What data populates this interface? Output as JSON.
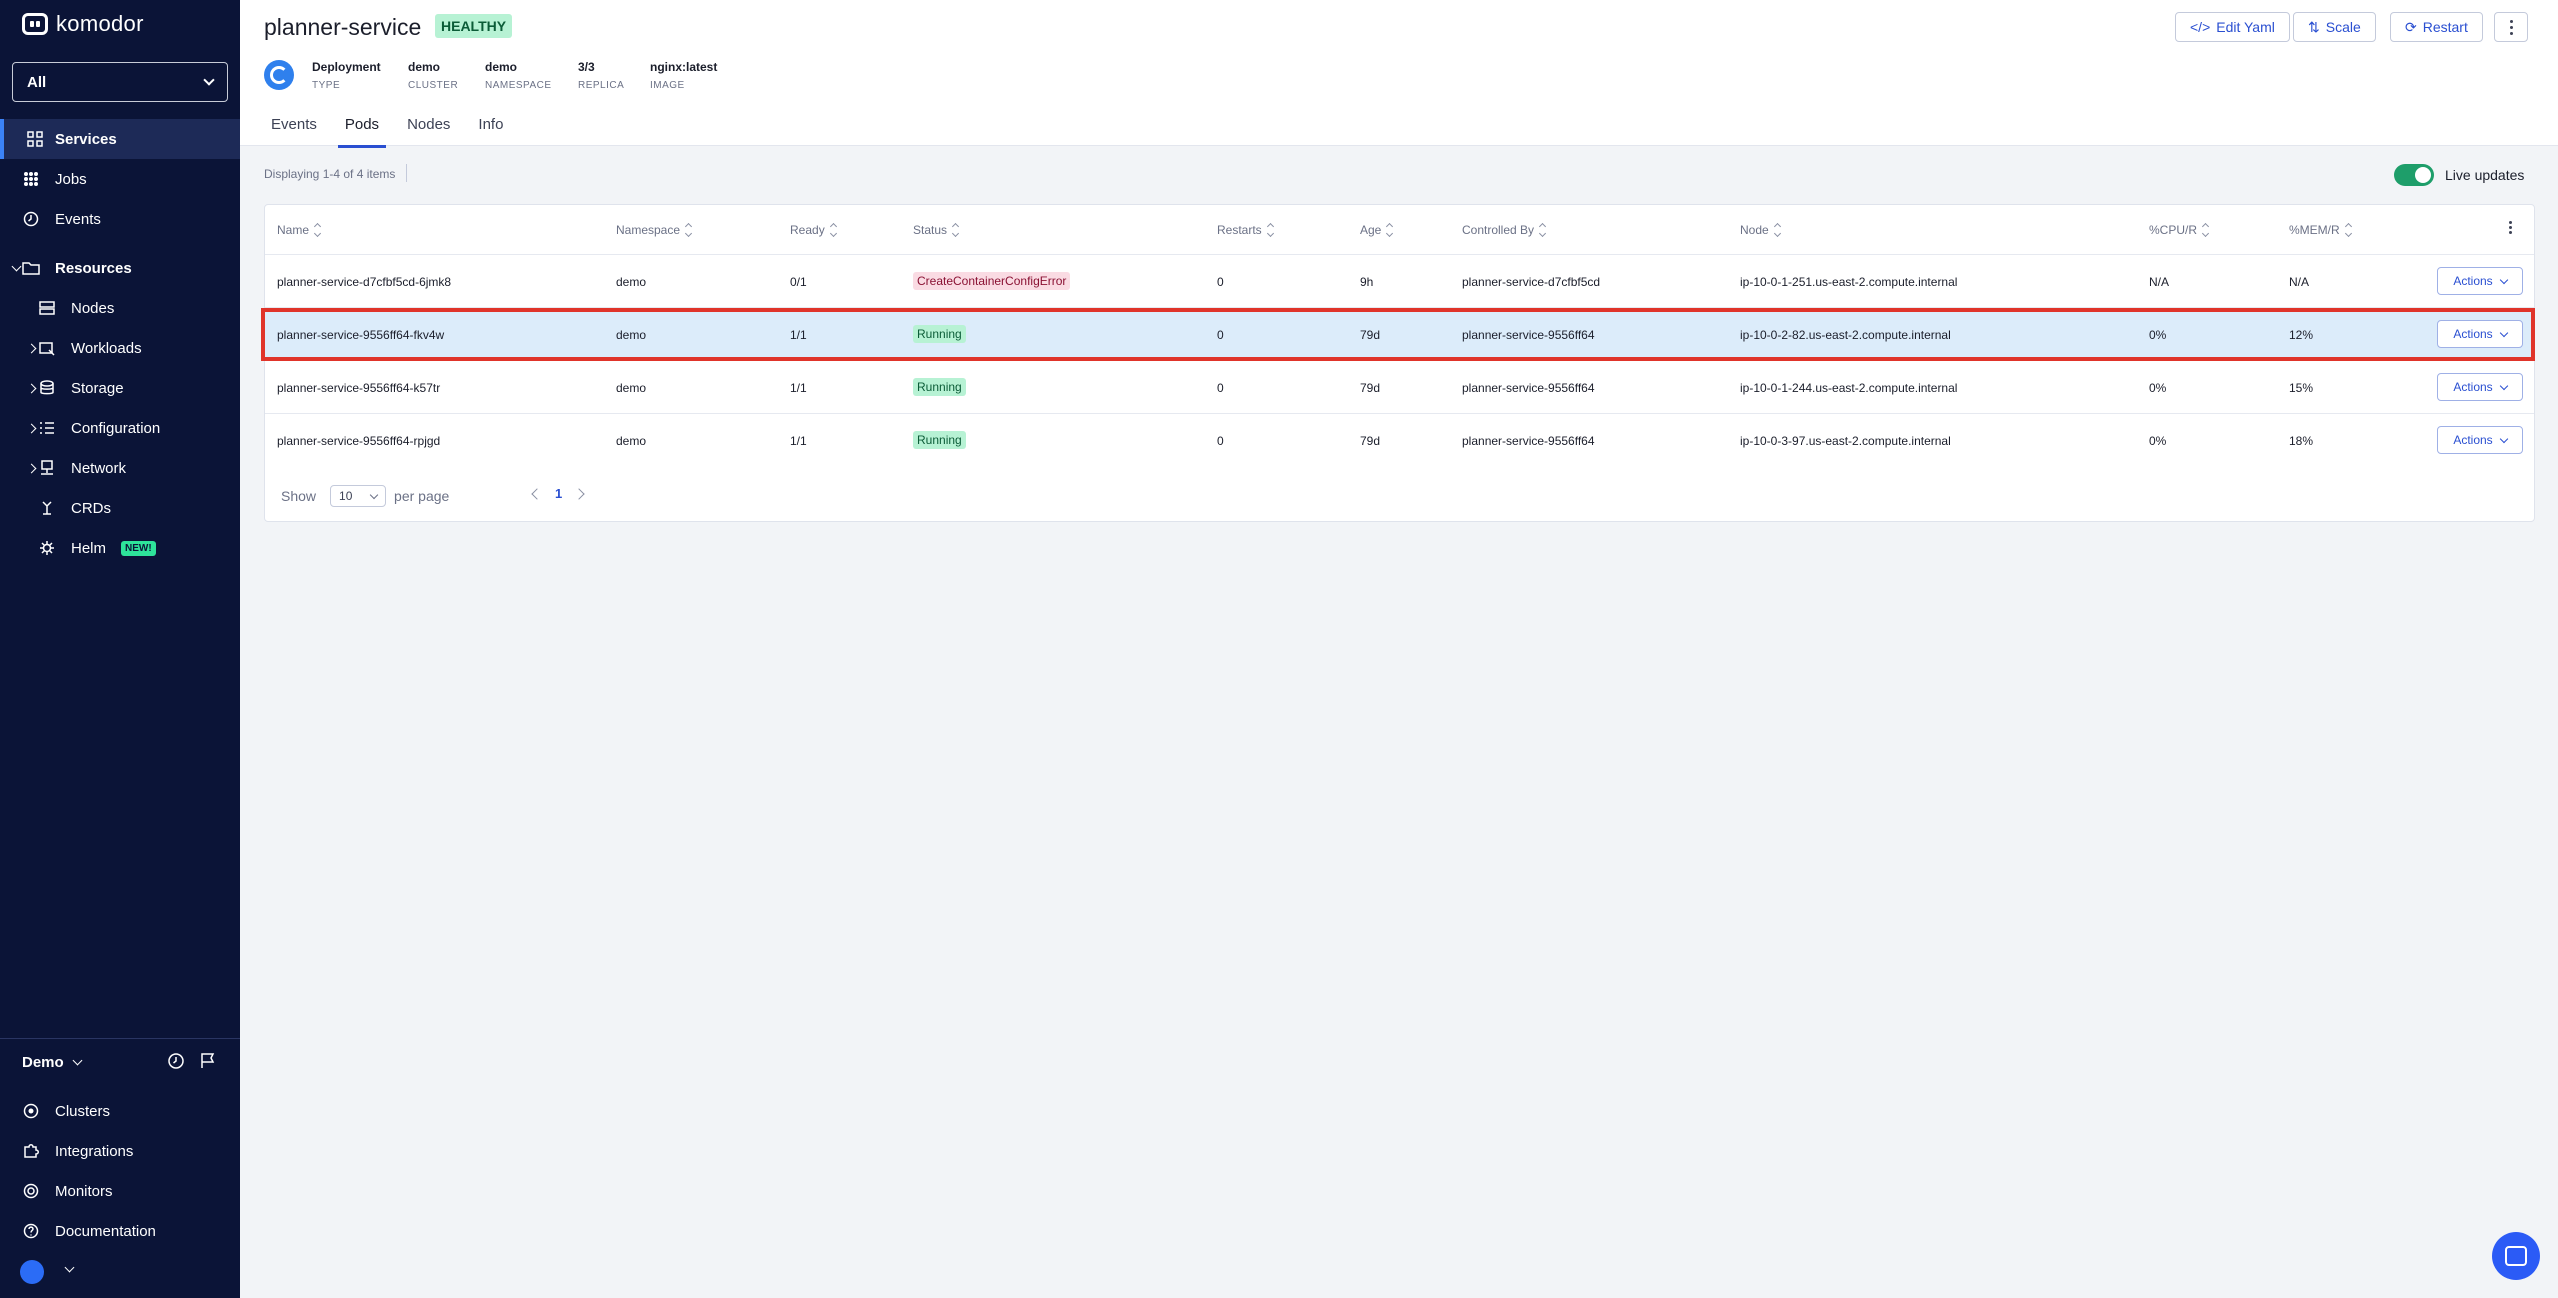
{
  "app": {
    "logo_text": "komodor",
    "workspace": "All"
  },
  "sidebar": {
    "items": [
      {
        "label": "Services",
        "icon": "grid-icon"
      },
      {
        "label": "Jobs",
        "icon": "dots-grid-icon"
      },
      {
        "label": "Events",
        "icon": "clock-icon"
      },
      {
        "label": "Resources",
        "icon": "folder-icon"
      },
      {
        "label": "Nodes",
        "icon": "server-icon"
      },
      {
        "label": "Workloads",
        "icon": "workloads-icon"
      },
      {
        "label": "Storage",
        "icon": "database-icon"
      },
      {
        "label": "Configuration",
        "icon": "list-icon"
      },
      {
        "label": "Network",
        "icon": "network-icon"
      },
      {
        "label": "CRDs",
        "icon": "crd-icon"
      },
      {
        "label": "Helm",
        "icon": "helm-icon",
        "badge": "NEW!"
      }
    ],
    "account": "Demo",
    "bottom": [
      {
        "label": "Clusters",
        "icon": "cluster-icon"
      },
      {
        "label": "Integrations",
        "icon": "puzzle-icon"
      },
      {
        "label": "Monitors",
        "icon": "radar-icon"
      },
      {
        "label": "Documentation",
        "icon": "help-icon"
      }
    ]
  },
  "header": {
    "title": "planner-service",
    "health": "HEALTHY",
    "meta": [
      {
        "value": "Deployment",
        "key": "TYPE"
      },
      {
        "value": "demo",
        "key": "CLUSTER"
      },
      {
        "value": "demo",
        "key": "NAMESPACE"
      },
      {
        "value": "3/3",
        "key": "REPLICA"
      },
      {
        "value": "nginx:latest",
        "key": "IMAGE"
      }
    ],
    "buttons": {
      "edit_yaml": "Edit Yaml",
      "scale": "Scale",
      "restart": "Restart"
    },
    "tabs": [
      "Events",
      "Pods",
      "Nodes",
      "Info"
    ],
    "active_tab": "Pods"
  },
  "content": {
    "count": "Displaying 1-4 of 4 items",
    "live_updates": "Live updates",
    "live_updates_on": true
  },
  "table": {
    "columns": [
      "Name",
      "Namespace",
      "Ready",
      "Status",
      "Restarts",
      "Age",
      "Controlled By",
      "Node",
      "%CPU/R",
      "%MEM/R"
    ],
    "rows": [
      {
        "name": "planner-service-d7cfbf5cd-6jmk8",
        "namespace": "demo",
        "ready": "0/1",
        "status": "CreateContainerConfigError",
        "restarts": "0",
        "age": "9h",
        "controlled_by": "planner-service-d7cfbf5cd",
        "node": "ip-10-0-1-251.us-east-2.compute.internal",
        "cpu": "N/A",
        "mem": "N/A",
        "action": "Actions"
      },
      {
        "name": "planner-service-9556ff64-fkv4w",
        "namespace": "demo",
        "ready": "1/1",
        "status": "Running",
        "restarts": "0",
        "age": "79d",
        "controlled_by": "planner-service-9556ff64",
        "node": "ip-10-0-2-82.us-east-2.compute.internal",
        "cpu": "0%",
        "mem": "12%",
        "action": "Actions"
      },
      {
        "name": "planner-service-9556ff64-k57tr",
        "namespace": "demo",
        "ready": "1/1",
        "status": "Running",
        "restarts": "0",
        "age": "79d",
        "controlled_by": "planner-service-9556ff64",
        "node": "ip-10-0-1-244.us-east-2.compute.internal",
        "cpu": "0%",
        "mem": "15%",
        "action": "Actions"
      },
      {
        "name": "planner-service-9556ff64-rpjgd",
        "namespace": "demo",
        "ready": "1/1",
        "status": "Running",
        "restarts": "0",
        "age": "79d",
        "controlled_by": "planner-service-9556ff64",
        "node": "ip-10-0-3-97.us-east-2.compute.internal",
        "cpu": "0%",
        "mem": "18%",
        "action": "Actions"
      }
    ],
    "pager": {
      "show": "Show",
      "per_page_value": "10",
      "per_page": "per page",
      "page": "1"
    }
  },
  "colors": {
    "sidebar_bg": "#0b1437",
    "accent": "#2a4fd1",
    "healthy": "#b7f2d4",
    "error": "#fadbe3",
    "highlight": "#e0342a"
  }
}
